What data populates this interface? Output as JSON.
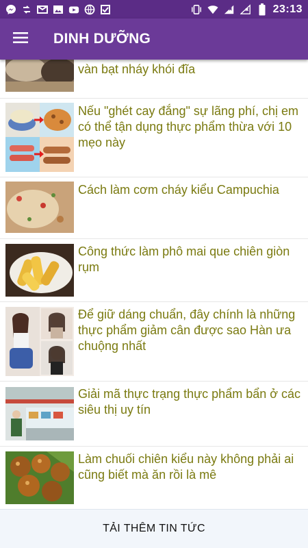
{
  "status_bar": {
    "time": "23:13",
    "left_icons": [
      "messenger-icon",
      "sync-icon",
      "gmail-icon",
      "photo-icon",
      "youtube-icon",
      "globe-icon",
      "tasks-icon"
    ],
    "right_icons": [
      "vibrate-icon",
      "wifi-icon",
      "signal-icon",
      "no-signal-icon",
      "battery-icon"
    ]
  },
  "app_bar": {
    "title": "DINH DƯỠNG",
    "menu_icon": "hamburger-menu-icon"
  },
  "articles": [
    {
      "title": "vàn bạt nháy khói đĩa"
    },
    {
      "title": "Nếu \"ghét cay đắng\" sự lãng phí, chị em có thể tận dụng thực phẩm thừa với 10 mẹo này"
    },
    {
      "title": "Cách làm cơm cháy kiểu Campuchia"
    },
    {
      "title": "Công thức làm phô mai que chiên giòn rụm"
    },
    {
      "title": "Để giữ dáng chuẩn, đây chính là những thực phẩm giảm cân được sao Hàn ưa chuộng nhất"
    },
    {
      "title": "Giải mã thực trạng thực phẩm bẩn ở các siêu thị uy tín"
    },
    {
      "title": "Làm chuối chiên kiểu này không phải ai cũng biết mà ăn rồi là mê"
    }
  ],
  "load_more": {
    "label": "TẢI THÊM TIN TỨC"
  },
  "colors": {
    "status_bar": "#5b2c86",
    "app_bar": "#6b3a98",
    "title_text": "#7a7a10"
  }
}
